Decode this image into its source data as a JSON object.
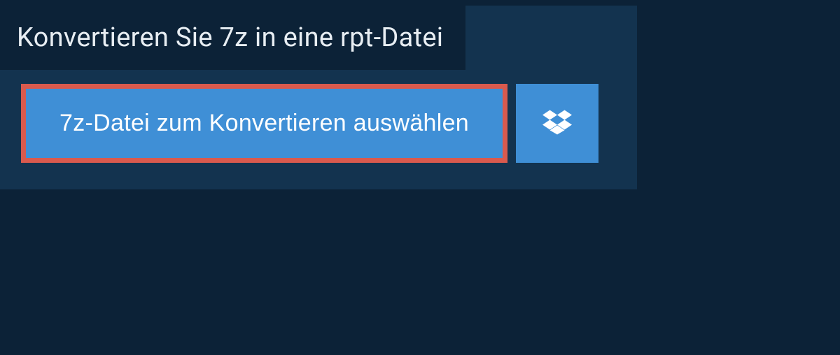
{
  "header": {
    "title": "Konvertieren Sie 7z in eine rpt-Datei"
  },
  "actions": {
    "select_file_label": "7z-Datei zum Konvertieren auswählen"
  },
  "colors": {
    "background": "#0c2237",
    "panel": "#13334f",
    "button": "#3f8fd6",
    "highlight_border": "#d95a4e"
  }
}
